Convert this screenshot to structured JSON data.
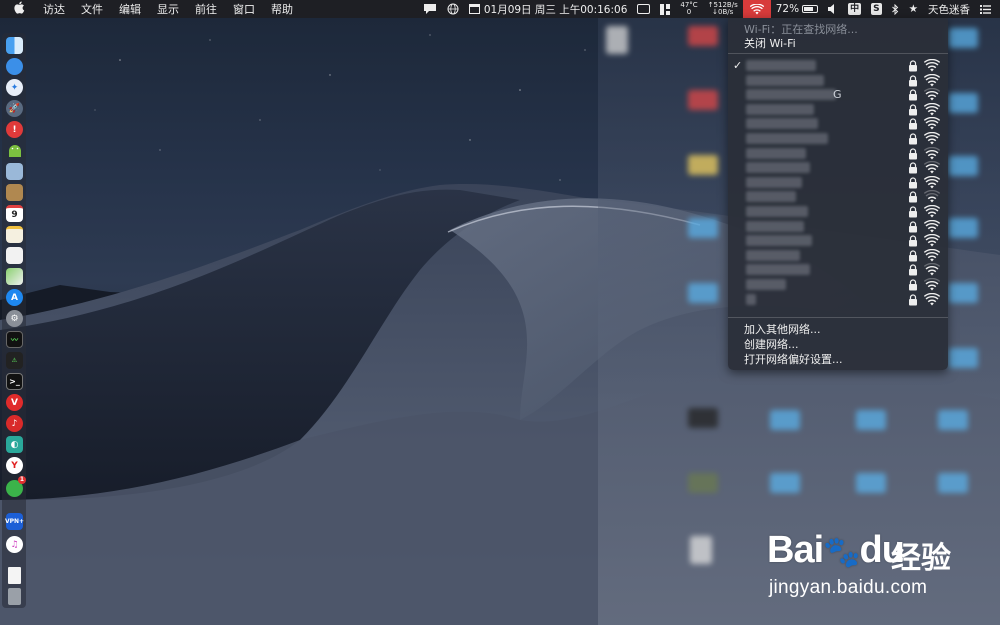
{
  "menubar": {
    "apple_icon": "apple-logo-icon",
    "menus": [
      "访达",
      "文件",
      "编辑",
      "显示",
      "前往",
      "窗口",
      "帮助"
    ],
    "datetime": "01月09日 周三 上午00:16:06",
    "temperature": "47°C",
    "temperature_sub": "0",
    "net_up": "↑512B/s",
    "net_down": "↓0B/s",
    "battery": "72%",
    "input_method": "中",
    "sogou": "S",
    "username": "天色迷香"
  },
  "wifi_menu": {
    "status": "Wi-Fi：正在查找网络...",
    "toggle": "关闭 Wi-Fi",
    "networks": [
      {
        "checked": true,
        "secured": true,
        "strength": 3,
        "visible_suffix": ""
      },
      {
        "checked": false,
        "secured": true,
        "strength": 3,
        "visible_suffix": ""
      },
      {
        "checked": false,
        "secured": true,
        "strength": 2,
        "visible_suffix": "G"
      },
      {
        "checked": false,
        "secured": true,
        "strength": 3,
        "visible_suffix": ""
      },
      {
        "checked": false,
        "secured": true,
        "strength": 3,
        "visible_suffix": ""
      },
      {
        "checked": false,
        "secured": true,
        "strength": 3,
        "visible_suffix": ""
      },
      {
        "checked": false,
        "secured": true,
        "strength": 2,
        "visible_suffix": ""
      },
      {
        "checked": false,
        "secured": true,
        "strength": 2,
        "visible_suffix": ""
      },
      {
        "checked": false,
        "secured": true,
        "strength": 3,
        "visible_suffix": ""
      },
      {
        "checked": false,
        "secured": true,
        "strength": 1,
        "visible_suffix": ""
      },
      {
        "checked": false,
        "secured": true,
        "strength": 3,
        "visible_suffix": ""
      },
      {
        "checked": false,
        "secured": true,
        "strength": 3,
        "visible_suffix": ""
      },
      {
        "checked": false,
        "secured": true,
        "strength": 3,
        "visible_suffix": ""
      },
      {
        "checked": false,
        "secured": true,
        "strength": 3,
        "visible_suffix": ""
      },
      {
        "checked": false,
        "secured": true,
        "strength": 2,
        "visible_suffix": ""
      },
      {
        "checked": false,
        "secured": true,
        "strength": 2,
        "visible_suffix": ""
      },
      {
        "checked": false,
        "secured": true,
        "strength": 3,
        "visible_suffix": ""
      }
    ],
    "actions": [
      "加入其他网络...",
      "创建网络...",
      "打开网络偏好设置..."
    ]
  },
  "dock": {
    "icons": [
      "finder-icon",
      "safari-icon",
      "safari-compass-icon",
      "launchpad-icon",
      "app-store-red-icon",
      "android-icon",
      "preview-icon",
      "notes-icon",
      "calendar-icon",
      "reminders-icon",
      "maps-icon",
      "app-store-icon",
      "system-preferences-icon",
      "activity-monitor-icon",
      "terminal-icon",
      "vivaldi-icon",
      "netease-music-icon",
      "green-app-icon",
      "yandex-icon",
      "wechat-icon",
      "vpn-icon",
      "itunes-icon",
      "document-icon",
      "trash-icon"
    ],
    "calendar_day": "9",
    "vpn_label": "VPN+",
    "wechat_badge": "1"
  },
  "watermark": {
    "brand": "Bai",
    "brand_end": "du",
    "cn": "经验",
    "url": "jingyan.baidu.com"
  },
  "colors": {
    "menubar_bg": "#1e1f24",
    "wifi_active": "#d83b3b",
    "menu_bg": "#2a2e38"
  }
}
